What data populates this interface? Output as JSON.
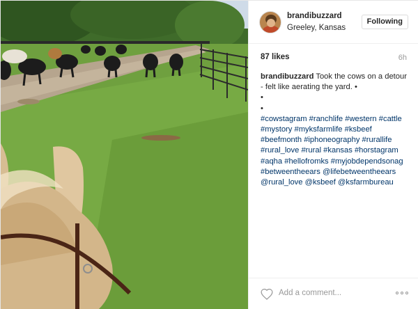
{
  "post": {
    "username": "brandibuzzard",
    "location": "Greeley, Kansas",
    "follow_label": "Following",
    "likes": "87 likes",
    "time": "6h",
    "caption_user": "brandibuzzard",
    "caption_lines": [
      "Took the cows on a detour",
      "- felt like aerating the yard. •",
      "•",
      "•",
      "#cowstagram #ranchlife #western #cattle",
      "#mystory #myksfarmlife #ksbeef",
      "#beefmonth #iphoneography #rurallife",
      "#rural_love #rural #kansas #horstagram",
      "#aqha #hellofromks #myjobdependsonag",
      "#betweentheears @lifebetweentheears",
      "@rural_love @ksbeef @ksfarmbureau"
    ],
    "add_comment_placeholder": "Add a comment...",
    "icons": {
      "like": "heart-icon",
      "more": "more-options-icon"
    }
  },
  "colors": {
    "link": "#003569",
    "text": "#262626",
    "muted": "#999999"
  }
}
